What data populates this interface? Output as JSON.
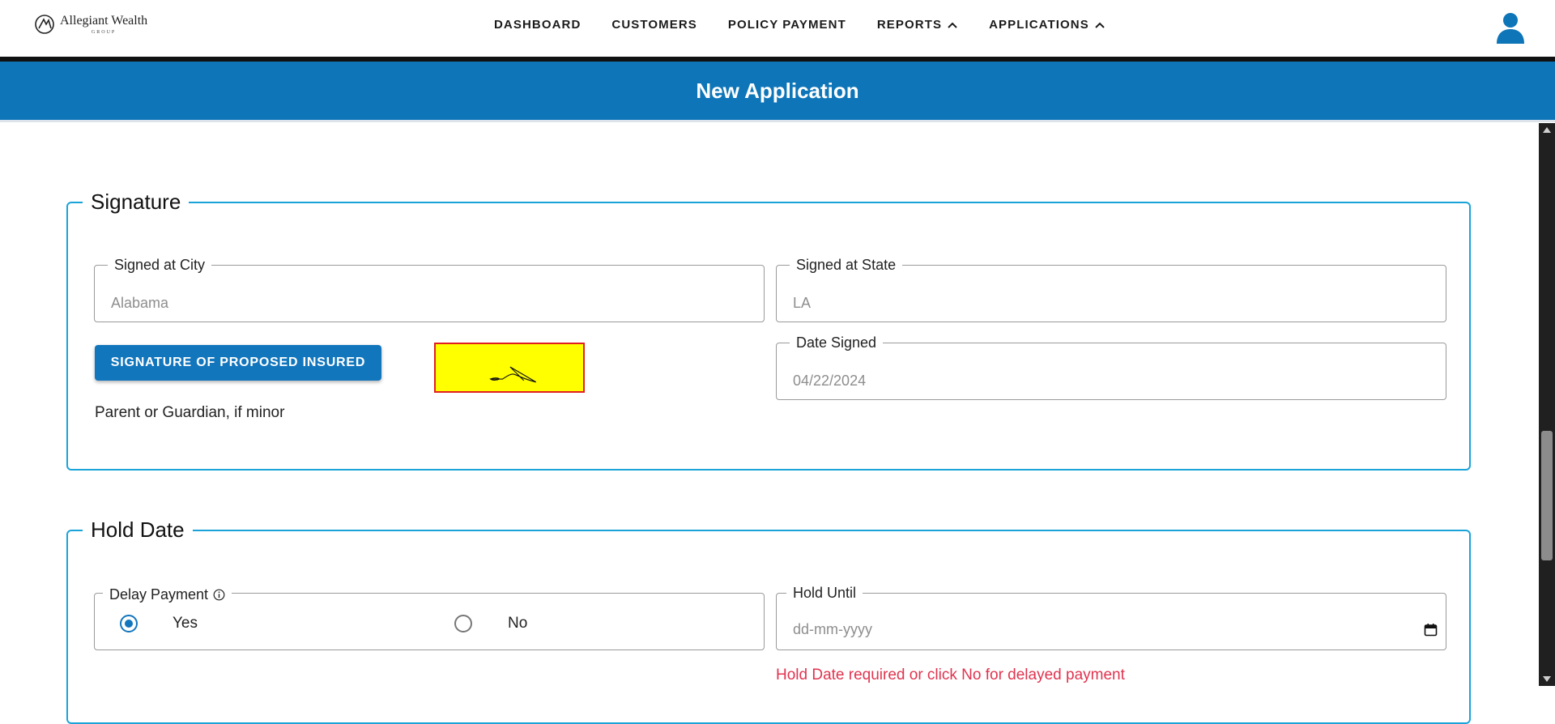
{
  "brand": {
    "name": "Allegiant Wealth",
    "sub": "GROUP",
    "logo_icon": "brand-logo-icon"
  },
  "nav": {
    "items": [
      {
        "label": "DASHBOARD",
        "has_chevron": false
      },
      {
        "label": "CUSTOMERS",
        "has_chevron": false
      },
      {
        "label": "POLICY PAYMENT",
        "has_chevron": false
      },
      {
        "label": "REPORTS",
        "has_chevron": true
      },
      {
        "label": "APPLICATIONS",
        "has_chevron": true
      }
    ],
    "user_icon": "user-icon"
  },
  "banner": {
    "title": "New Application"
  },
  "signature": {
    "legend": "Signature",
    "city": {
      "label": "Signed at City",
      "value": "Alabama"
    },
    "state": {
      "label": "Signed at State",
      "value": "LA"
    },
    "button_label": "SIGNATURE OF PROPOSED INSURED",
    "guardian_text": "Parent or Guardian, if minor",
    "date": {
      "label": "Date Signed",
      "value": "04/22/2024"
    }
  },
  "hold_date": {
    "legend": "Hold Date",
    "delay": {
      "label": "Delay Payment",
      "options": [
        {
          "label": "Yes",
          "checked": true
        },
        {
          "label": "No",
          "checked": false
        }
      ]
    },
    "hold_until": {
      "label": "Hold Until",
      "placeholder": "dd-mm-yyyy"
    },
    "error": "Hold Date required or click No for delayed payment"
  },
  "colors": {
    "primary": "#0e75b8",
    "accent_border": "#1aa3d9",
    "error": "#e0344f",
    "signature_bg": "#ffff00"
  }
}
